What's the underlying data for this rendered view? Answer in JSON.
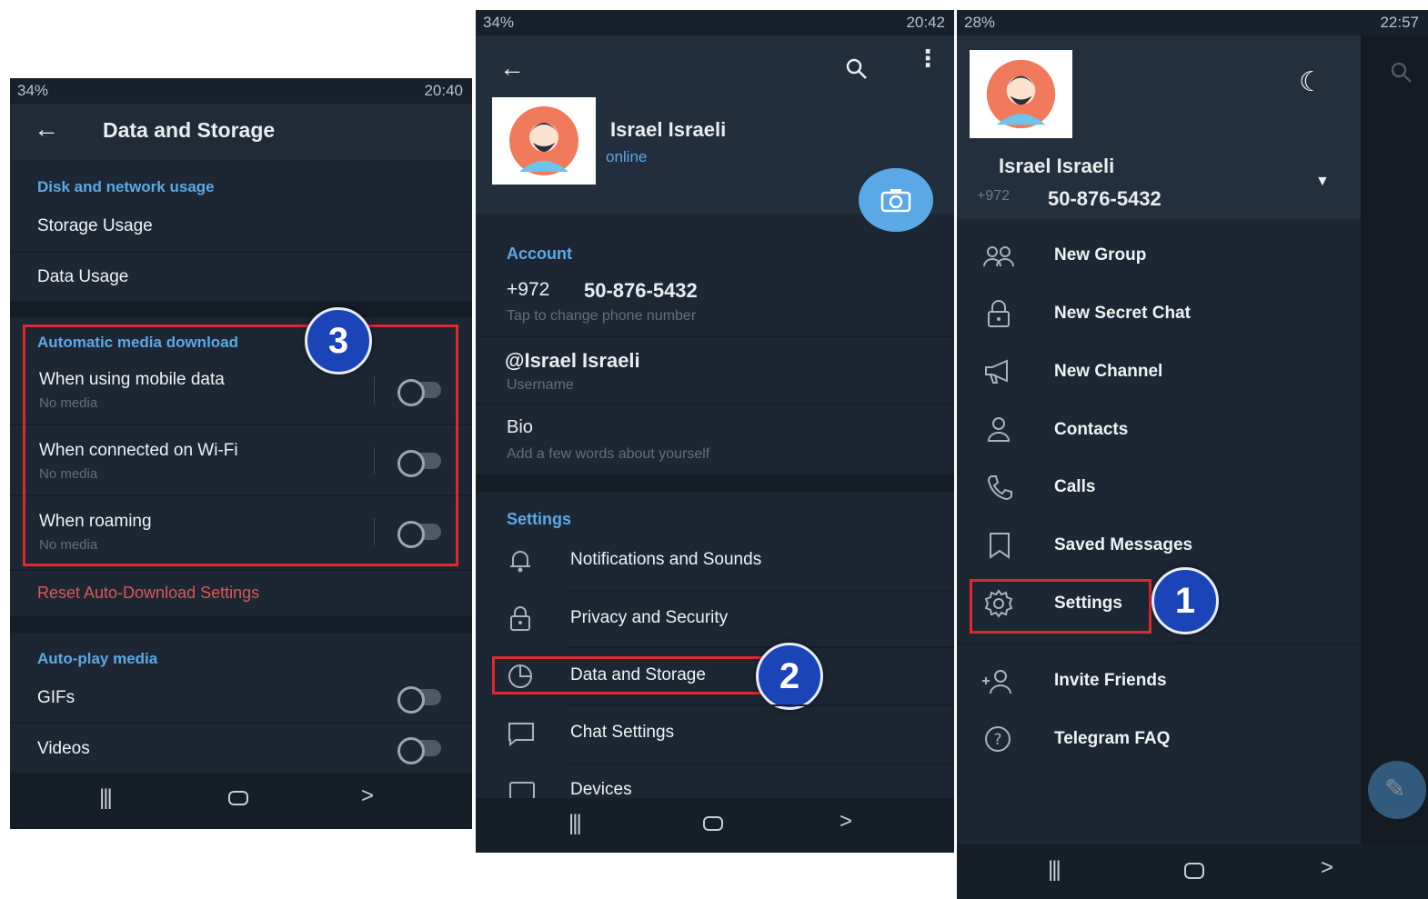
{
  "panel1": {
    "status": {
      "battery": "34%",
      "time": "20:40"
    },
    "title": "Data and Storage",
    "disk_section": "Disk and network usage",
    "storage_usage": "Storage Usage",
    "data_usage": "Data Usage",
    "auto_section": "Automatic media download",
    "mobile_data": {
      "label": "When using mobile data",
      "sub": "No media"
    },
    "wifi": {
      "label": "When connected on Wi-Fi",
      "sub": "No media"
    },
    "roaming": {
      "label": "When roaming",
      "sub": "No media"
    },
    "reset": "Reset Auto-Download Settings",
    "autoplay_section": "Auto-play media",
    "gifs": "GIFs",
    "videos": "Videos",
    "step": "3"
  },
  "panel2": {
    "status": {
      "battery": "34%",
      "time": "20:42"
    },
    "name": "Israel Israeli",
    "presence": "online",
    "account_section": "Account",
    "country_code": "+972",
    "phone": "50-876-5432",
    "phone_hint": "Tap to change phone number",
    "username": "@Israel Israeli",
    "username_label": "Username",
    "bio": "Bio",
    "bio_hint": "Add a few words about yourself",
    "settings_section": "Settings",
    "notifications": "Notifications and Sounds",
    "privacy": "Privacy and Security",
    "data_storage": "Data and Storage",
    "chat_settings": "Chat Settings",
    "devices": "Devices",
    "step": "2"
  },
  "panel3": {
    "status": {
      "battery": "28%",
      "time": "22:57"
    },
    "name": "Israel Israeli",
    "country_code": "+972",
    "phone": "50-876-5432",
    "menu": {
      "new_group": "New Group",
      "new_secret_chat": "New Secret Chat",
      "new_channel": "New Channel",
      "contacts": "Contacts",
      "calls": "Calls",
      "saved_messages": "Saved Messages",
      "settings": "Settings",
      "invite_friends": "Invite Friends",
      "faq": "Telegram FAQ"
    },
    "step": "1"
  },
  "colors": {
    "panel_bg": "#1d2733",
    "accent": "#5aa9e6",
    "highlight": "#e0282e",
    "badge": "#1b44b8",
    "reset": "#d9585a"
  }
}
